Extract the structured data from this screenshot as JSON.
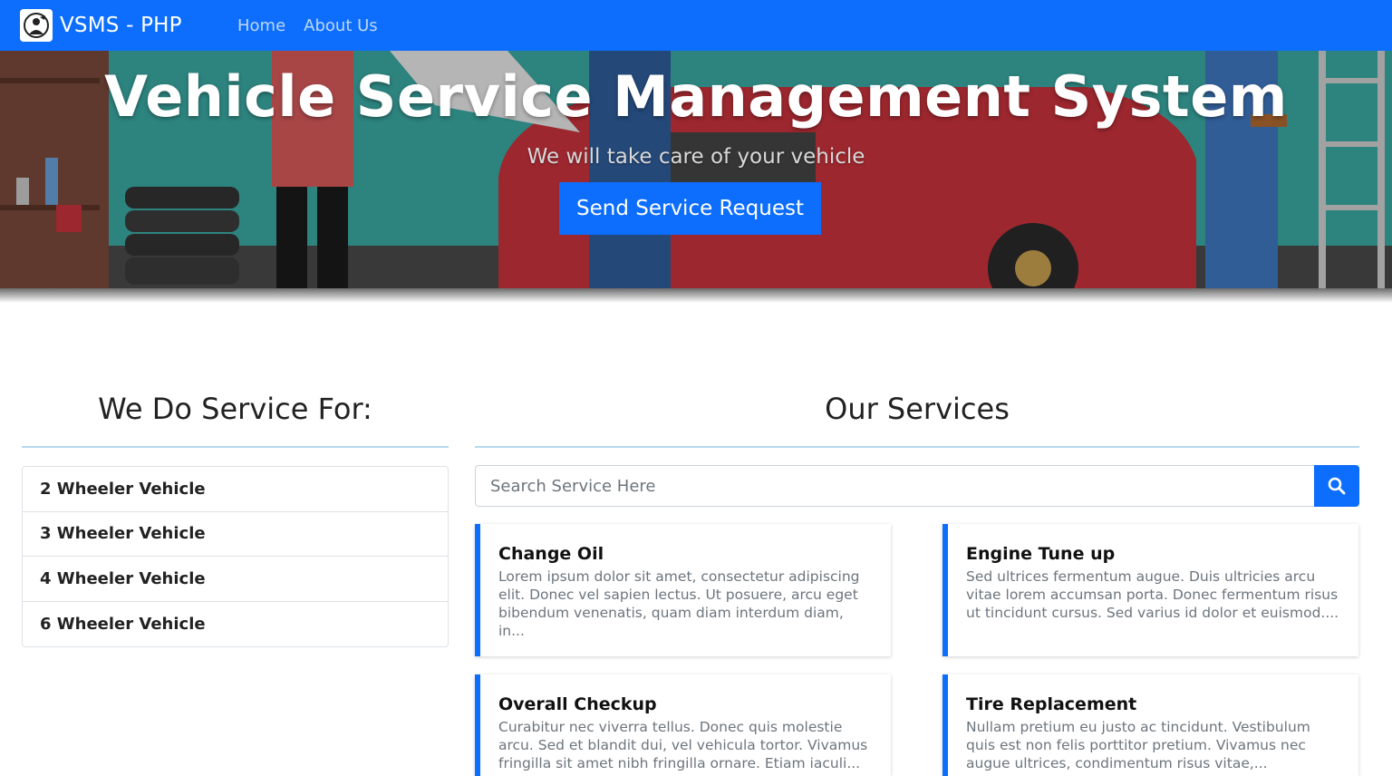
{
  "navbar": {
    "brand": "VSMS - PHP",
    "links": [
      {
        "label": "Home"
      },
      {
        "label": "About Us"
      }
    ]
  },
  "hero": {
    "title": "Vehicle Service Management System",
    "subtitle": "We will take care of your vehicle",
    "button_label": "Send Service Request"
  },
  "left": {
    "title": "We Do Service For:",
    "items": [
      {
        "label": "2 Wheeler Vehicle"
      },
      {
        "label": "3 Wheeler Vehicle"
      },
      {
        "label": "4 Wheeler Vehicle"
      },
      {
        "label": "6 Wheeler Vehicle"
      }
    ]
  },
  "right": {
    "title": "Our Services",
    "search_placeholder": "Search Service Here",
    "services": [
      {
        "title": "Change Oil",
        "description": "Lorem ipsum dolor sit amet, consectetur adipiscing elit. Donec vel sapien lectus. Ut posuere, arcu eget bibendum venenatis, quam diam interdum diam, in..."
      },
      {
        "title": "Engine Tune up",
        "description": "Sed ultrices fermentum augue. Duis ultricies arcu vitae lorem accumsan porta. Donec fermentum risus ut tincidunt cursus. Sed varius id dolor et euismod...."
      },
      {
        "title": "Overall Checkup",
        "description": "Curabitur nec viverra tellus. Donec quis molestie arcu. Sed et blandit dui, vel vehicula tortor. Vivamus fringilla sit amet nibh fringilla ornare. Etiam iaculi..."
      },
      {
        "title": "Tire Replacement",
        "description": "Nullam pretium eu justo ac tincidunt. Vestibulum quis est non felis porttitor pretium. Vivamus nec augue ultrices, condimentum risus vitae,..."
      }
    ]
  },
  "colors": {
    "primary": "#0d6efd",
    "hero_teal": "#3aa8a2",
    "car_red": "#c8323c"
  }
}
